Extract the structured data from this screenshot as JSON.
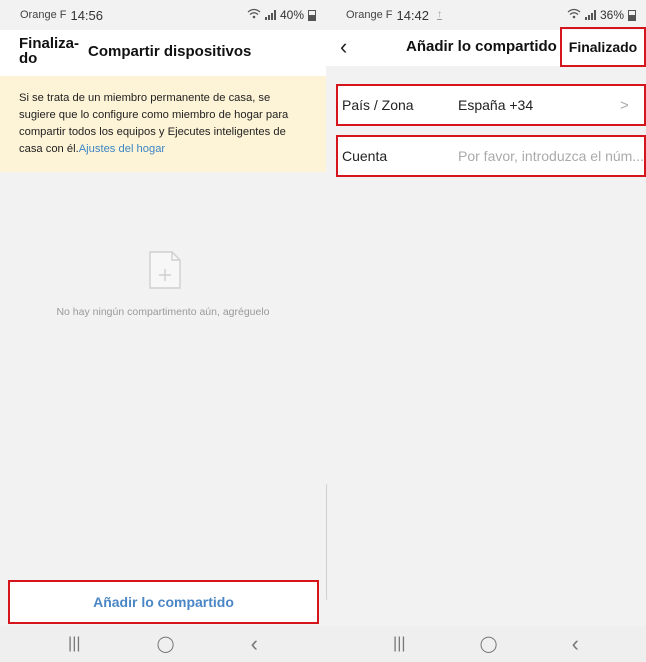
{
  "left": {
    "status": {
      "carrier": "Orange F",
      "time": "14:56",
      "battery": "40%"
    },
    "header": {
      "back_label": "Finaliza-do",
      "title": "Compartir dispositivos"
    },
    "notice": {
      "text": "Si se trata de un miembro permanente de casa, se sugiere que lo configure como miembro de hogar para compartir todos los equipos y Ejecutes inteligentes de casa con él.",
      "link": "Ajustes del hogar"
    },
    "empty": {
      "icon": "add-file-icon",
      "text": "No hay ningún compartimento aún, agréguelo"
    },
    "add_button": "Añadir lo compartido",
    "navbar": {
      "recents": "|||",
      "home": "◯",
      "back": "‹"
    }
  },
  "right": {
    "status": {
      "carrier": "Orange F",
      "time": "14:42",
      "battery": "36%"
    },
    "header": {
      "back": "‹",
      "title": "Añadir lo compartido",
      "done": "Finalizado"
    },
    "country_row": {
      "label": "País / Zona",
      "value": "España +34"
    },
    "account_row": {
      "label": "Cuenta",
      "placeholder": "Por favor, introduzca el núm..."
    },
    "navbar": {
      "recents": "|||",
      "home": "◯",
      "back": "‹"
    }
  },
  "colors": {
    "highlight": "#d6141c",
    "link": "#3d86c6",
    "notice_bg": "#fdf3d6"
  }
}
